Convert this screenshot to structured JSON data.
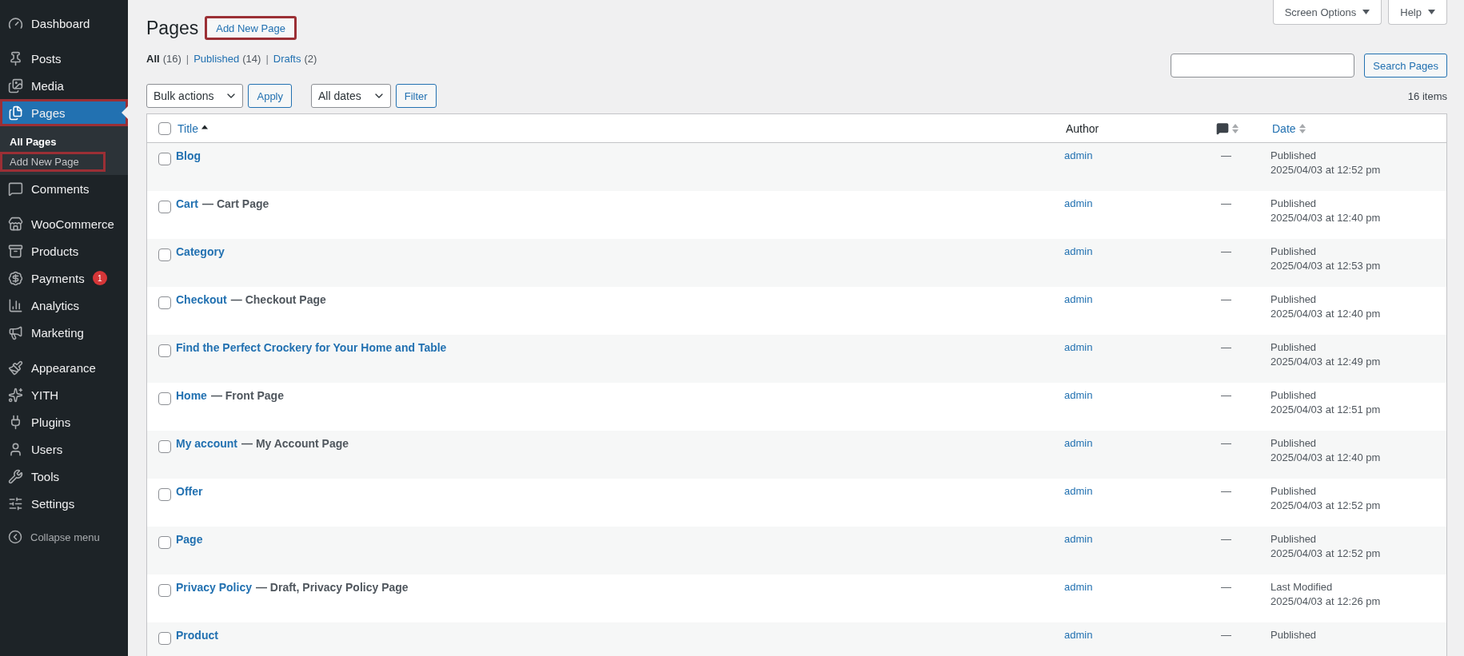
{
  "sidebar": {
    "groups": [
      {
        "items": [
          {
            "label": "Dashboard",
            "selected": false,
            "highlighted": false
          }
        ]
      },
      {
        "items": [
          {
            "label": "Posts",
            "selected": false,
            "highlighted": false
          },
          {
            "label": "Media",
            "selected": false,
            "highlighted": false
          },
          {
            "label": "Pages",
            "selected": true,
            "highlighted": true,
            "children": [
              {
                "label": "All Pages",
                "selected": true,
                "highlighted": false
              },
              {
                "label": "Add New Page",
                "selected": false,
                "highlighted": true
              }
            ]
          },
          {
            "label": "Comments",
            "selected": false,
            "highlighted": false
          }
        ]
      },
      {
        "items": [
          {
            "label": "WooCommerce",
            "selected": false,
            "highlighted": false
          },
          {
            "label": "Products",
            "selected": false,
            "highlighted": false
          },
          {
            "label": "Payments",
            "selected": false,
            "highlighted": false,
            "badge": "1"
          },
          {
            "label": "Analytics",
            "selected": false,
            "highlighted": false
          },
          {
            "label": "Marketing",
            "selected": false,
            "highlighted": false
          }
        ]
      },
      {
        "items": [
          {
            "label": "Appearance",
            "selected": false,
            "highlighted": false
          },
          {
            "label": "YITH",
            "selected": false,
            "highlighted": false
          },
          {
            "label": "Plugins",
            "selected": false,
            "highlighted": false
          },
          {
            "label": "Users",
            "selected": false,
            "highlighted": false
          },
          {
            "label": "Tools",
            "selected": false,
            "highlighted": false
          },
          {
            "label": "Settings",
            "selected": false,
            "highlighted": false
          }
        ]
      }
    ],
    "collapse": "Collapse menu"
  },
  "header": {
    "title": "Pages",
    "add_button": {
      "label": "Add New Page",
      "highlighted": true
    },
    "screen_options": "Screen Options",
    "help": "Help"
  },
  "views": [
    {
      "label": "All",
      "count": "(16)",
      "selected": true
    },
    {
      "separator": "|",
      "label": "Published",
      "count": "(14)",
      "selected": false
    },
    {
      "separator": "|",
      "label": "Drafts",
      "count": "(2)",
      "selected": false
    }
  ],
  "search": {
    "button": "Search Pages"
  },
  "filters": {
    "bulk_actions": "Bulk actions",
    "apply": "Apply",
    "dates": "All dates",
    "filter": "Filter",
    "items_count": "16 items"
  },
  "table": {
    "select_all_checked": false,
    "columns": [
      {
        "kind": "text",
        "label": "Title",
        "sortable": true,
        "sorted": true
      },
      {
        "kind": "text",
        "label": "Author",
        "sortable": false
      },
      {
        "kind": "icon",
        "sortable": true,
        "sorted": false
      },
      {
        "kind": "text",
        "label": "Date",
        "sortable": true,
        "sorted": false
      }
    ],
    "rows": [
      {
        "checked": false,
        "title": "Blog",
        "author": "admin",
        "comments": "—",
        "status": "Published",
        "date": "2025/04/03 at 12:52 pm"
      },
      {
        "checked": false,
        "title": "Cart",
        "post_state": "— Cart Page",
        "author": "admin",
        "comments": "—",
        "status": "Published",
        "date": "2025/04/03 at 12:40 pm"
      },
      {
        "checked": false,
        "title": "Category",
        "author": "admin",
        "comments": "—",
        "status": "Published",
        "date": "2025/04/03 at 12:53 pm"
      },
      {
        "checked": false,
        "title": "Checkout",
        "post_state": "— Checkout Page",
        "author": "admin",
        "comments": "—",
        "status": "Published",
        "date": "2025/04/03 at 12:40 pm"
      },
      {
        "checked": false,
        "title": "Find the Perfect Crockery for Your Home and Table",
        "author": "admin",
        "comments": "—",
        "status": "Published",
        "date": "2025/04/03 at 12:49 pm"
      },
      {
        "checked": false,
        "title": "Home",
        "post_state": "— Front Page",
        "author": "admin",
        "comments": "—",
        "status": "Published",
        "date": "2025/04/03 at 12:51 pm"
      },
      {
        "checked": false,
        "title": "My account",
        "post_state": "— My Account Page",
        "author": "admin",
        "comments": "—",
        "status": "Published",
        "date": "2025/04/03 at 12:40 pm"
      },
      {
        "checked": false,
        "title": "Offer",
        "author": "admin",
        "comments": "—",
        "status": "Published",
        "date": "2025/04/03 at 12:52 pm"
      },
      {
        "checked": false,
        "title": "Page",
        "author": "admin",
        "comments": "—",
        "status": "Published",
        "date": "2025/04/03 at 12:52 pm"
      },
      {
        "checked": false,
        "title": "Privacy Policy",
        "post_state": "— Draft, Privacy Policy Page",
        "author": "admin",
        "comments": "—",
        "status": "Last Modified",
        "date": "2025/04/03 at 12:26 pm"
      },
      {
        "checked": false,
        "title": "Product",
        "author": "admin",
        "comments": "—",
        "status": "Published"
      }
    ]
  }
}
